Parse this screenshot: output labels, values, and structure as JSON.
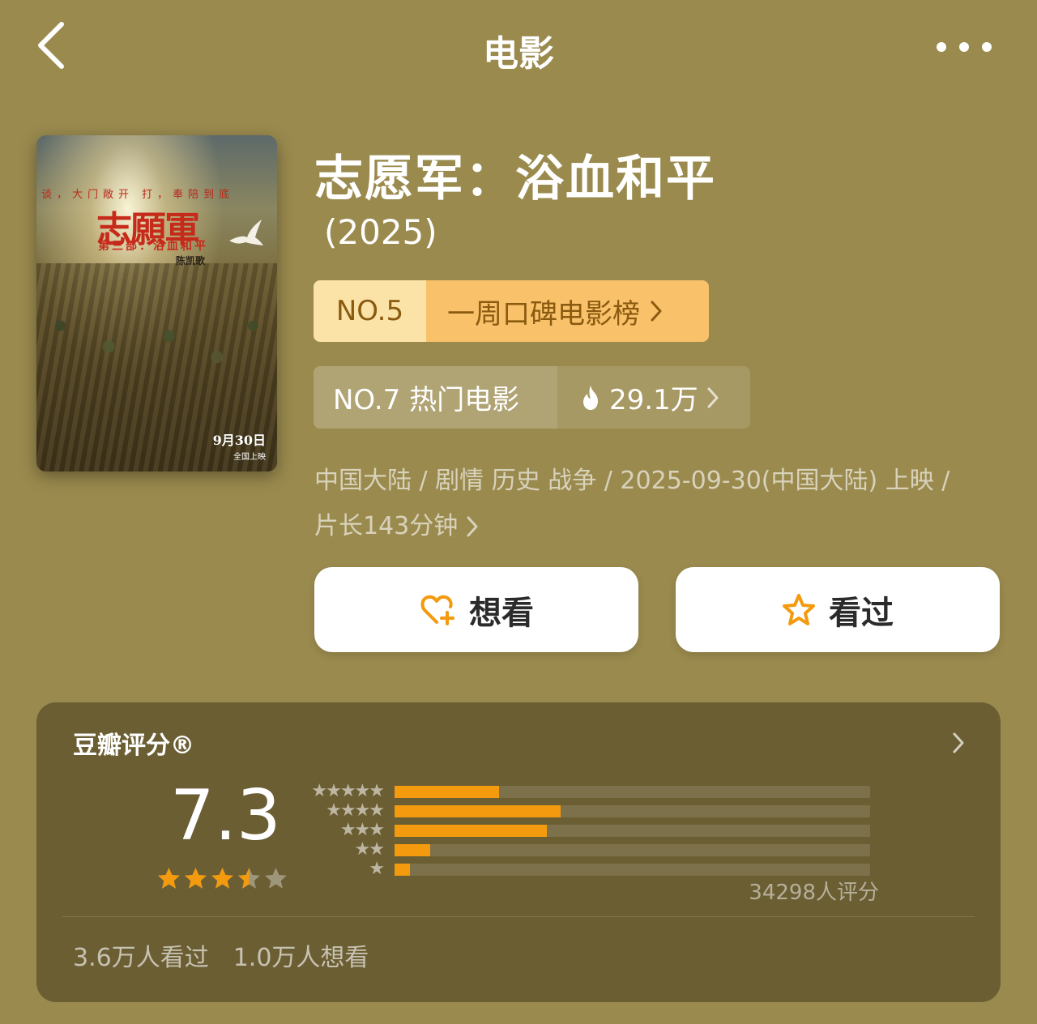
{
  "header": {
    "title": "电影"
  },
  "poster": {
    "tagline": "谈，大门敞开  打，奉陪到底",
    "title_art": "志願軍",
    "subtitle_art": "第三部：浴血和平",
    "director_art": "陈凯歌",
    "date_art": "9月30日",
    "release_art": "全国上映"
  },
  "movie": {
    "title": "志愿军：浴血和平",
    "year": "(2025)"
  },
  "rank_badge": {
    "no": "NO.5",
    "name": "一周口碑电影榜"
  },
  "hot_badge": {
    "rank": "NO.7 热门电影",
    "count": "29.1万"
  },
  "meta": {
    "line1": "中国大陆 / 剧情 历史 战争 / 2025-09-30(中国大陆) 上映 /",
    "line2": "片长143分钟"
  },
  "actions": {
    "want_label": "想看",
    "seen_label": "看过"
  },
  "rating": {
    "label": "豆瓣评分®",
    "score": "7.3",
    "star_rating": 3.5,
    "distribution": [
      {
        "stars": "★★★★★",
        "fraction": 0.22
      },
      {
        "stars": "★★★★",
        "fraction": 0.35
      },
      {
        "stars": "★★★",
        "fraction": 0.32
      },
      {
        "stars": "★★",
        "fraction": 0.075
      },
      {
        "stars": "★",
        "fraction": 0.033
      }
    ],
    "raters": "34298人评分",
    "seen_count": "3.6万人看过",
    "want_count": "1.0万人想看"
  },
  "colors": {
    "background": "#9a8a4e",
    "accent_orange": "#f39a0e",
    "rank_gold": "#f8c16a",
    "rank_text": "#8a5a10"
  },
  "icons": [
    "back-arrow-icon",
    "more-dots-icon",
    "flame-icon",
    "heart-plus-icon",
    "star-outline-icon",
    "chevron-right-icon"
  ]
}
